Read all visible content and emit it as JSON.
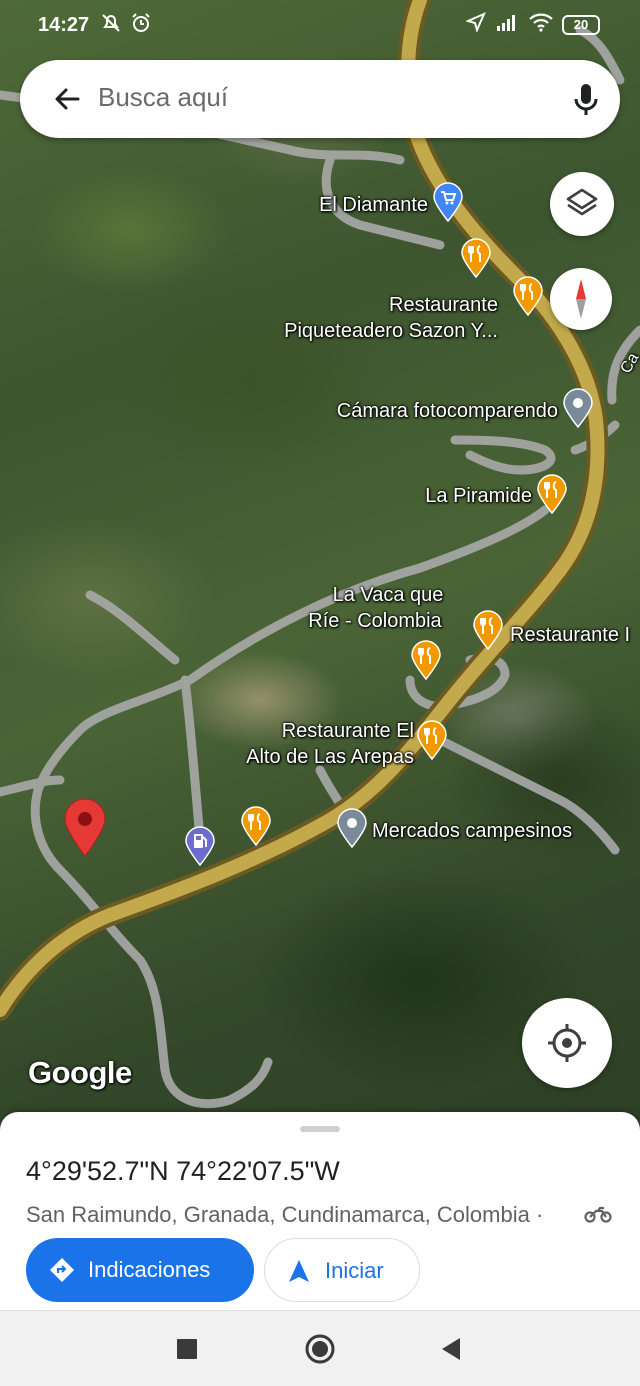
{
  "status_bar": {
    "time": "14:27",
    "battery": "20"
  },
  "search": {
    "placeholder": "Busca aquí"
  },
  "map": {
    "attribution": "Google",
    "places": {
      "diamante": "El Diamante",
      "sazon_1": "Restaurante",
      "sazon_2": "Piqueteadero Sazon Y...",
      "camara": "Cámara fotocomparendo",
      "piramide": "La Piramide",
      "vaca_1": "La Vaca que",
      "vaca_2": "Ríe - Colombia",
      "restaurante_edge": "Restaurante I",
      "arepas_1": "Restaurante El",
      "arepas_2": "Alto de Las Arepas",
      "mercados": "Mercados campesinos",
      "road_edge": "Ca"
    },
    "colors": {
      "highway": "#b8a24a",
      "road": "#b5b5b5",
      "restaurant_pin": "#f29900",
      "dropped_pin": "#e53935",
      "gas_pin": "#6d6ccf",
      "shop_pin": "#4285f4",
      "generic_pin": "#7a8a9a"
    }
  },
  "sheet": {
    "coordinates": "4°29'52.7\"N 74°22'07.5\"W",
    "address": "San Raimundo, Granada, Cundinamarca, Colombia ·",
    "directions_label": "Indicaciones",
    "start_label": "Iniciar"
  },
  "icons": [
    "back-arrow-icon",
    "mic-icon",
    "layers-icon",
    "compass-icon",
    "my-location-icon",
    "directions-icon",
    "navigation-icon",
    "motorcycle-icon"
  ]
}
